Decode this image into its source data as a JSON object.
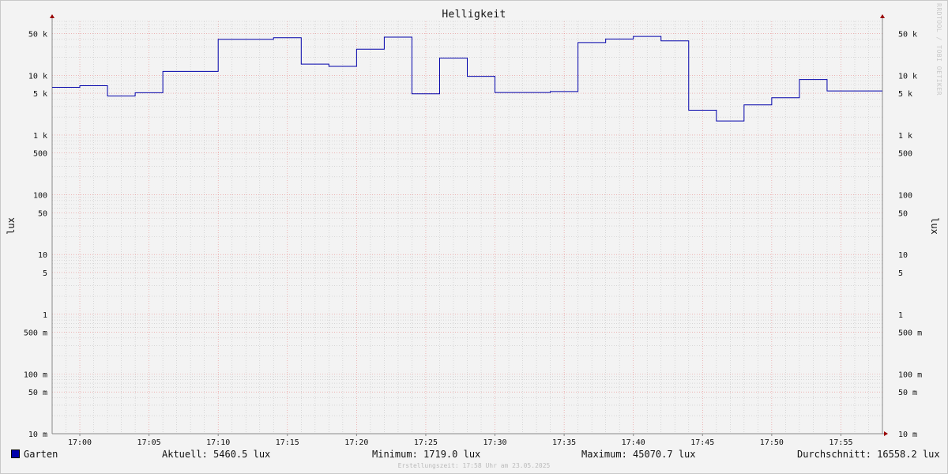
{
  "title": "Helligkeit",
  "watermark": "RRDTOOL / TOBI OETIKER",
  "ylabel": "lux",
  "legend": {
    "series_name": "Garten",
    "current": "Aktuell: 5460.5 lux",
    "minimum": "Minimum: 1719.0 lux",
    "maximum": "Maximum: 45070.7 lux",
    "average": "Durchschnitt: 16558.2 lux"
  },
  "footer": "Erstellungszeit: 17:58 Uhr am 23.05.2025",
  "colors": {
    "series": "#0000aa",
    "background": "#f3f3f3",
    "major_grid": "#e88a8a",
    "minor_grid": "#c4c4c4",
    "axis": "#888888",
    "arrow": "#990000"
  },
  "chart_data": {
    "type": "line",
    "title": "Helligkeit",
    "xlabel": "",
    "ylabel": "lux",
    "yscale": "log",
    "ylim": [
      0.01,
      80000
    ],
    "xlim": [
      "16:58",
      "17:58"
    ],
    "grid": true,
    "x_ticks": [
      "17:00",
      "17:05",
      "17:10",
      "17:15",
      "17:20",
      "17:25",
      "17:30",
      "17:35",
      "17:40",
      "17:45",
      "17:50",
      "17:55"
    ],
    "y_ticks": [
      {
        "value": 0.01,
        "label": "10 m"
      },
      {
        "value": 0.05,
        "label": "50 m"
      },
      {
        "value": 0.1,
        "label": "100 m"
      },
      {
        "value": 0.5,
        "label": "500 m"
      },
      {
        "value": 1,
        "label": "1"
      },
      {
        "value": 5,
        "label": "5"
      },
      {
        "value": 10,
        "label": "10"
      },
      {
        "value": 50,
        "label": "50"
      },
      {
        "value": 100,
        "label": "100"
      },
      {
        "value": 500,
        "label": "500"
      },
      {
        "value": 1000,
        "label": "1 k"
      },
      {
        "value": 5000,
        "label": "5 k"
      },
      {
        "value": 10000,
        "label": "10 k"
      },
      {
        "value": 50000,
        "label": "50 k"
      }
    ],
    "series": [
      {
        "name": "Garten",
        "step": true,
        "x": [
          "16:58",
          "17:00",
          "17:02",
          "17:04",
          "17:06",
          "17:10",
          "17:14",
          "17:16",
          "17:18",
          "17:20",
          "17:22",
          "17:24",
          "17:26",
          "17:28",
          "17:30",
          "17:34",
          "17:36",
          "17:38",
          "17:40",
          "17:42",
          "17:44",
          "17:46",
          "17:48",
          "17:50",
          "17:52",
          "17:54",
          "17:58"
        ],
        "values": [
          6300,
          6700,
          4500,
          5100,
          11600,
          40000,
          42500,
          15400,
          14100,
          27300,
          43500,
          4900,
          19400,
          9600,
          5150,
          5350,
          35300,
          40500,
          44700,
          37700,
          2600,
          1720,
          3200,
          4200,
          8500,
          5460,
          5460
        ]
      }
    ]
  }
}
